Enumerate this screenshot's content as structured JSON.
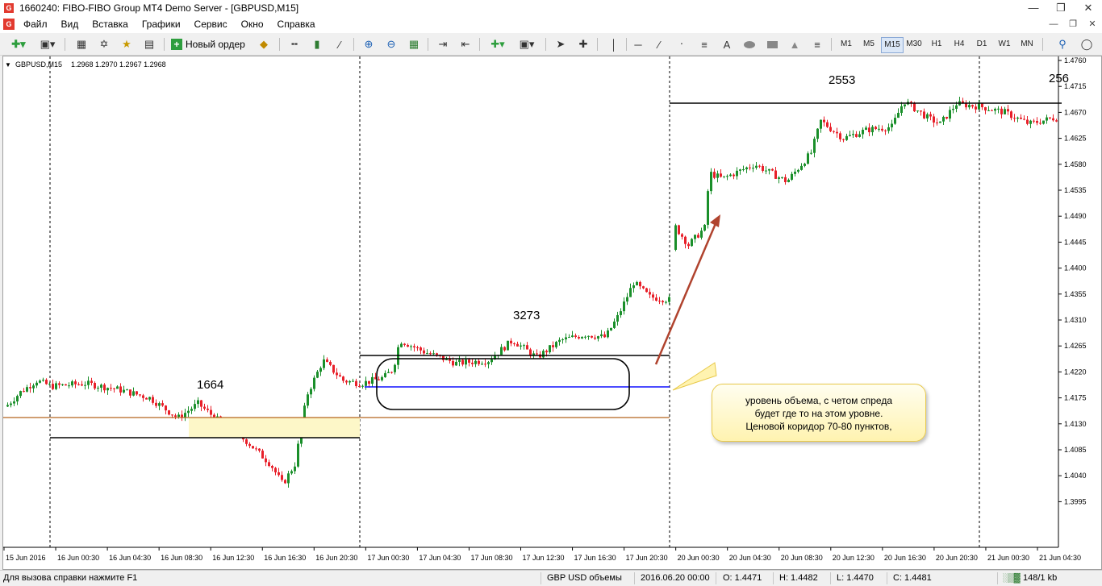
{
  "window": {
    "title": "1660240: FIBO-FIBO Group MT4 Demo Server - [GBPUSD,M15]",
    "app_icon": "G",
    "controls": [
      "minimize-icon",
      "maximize-icon",
      "close-icon"
    ]
  },
  "menu": {
    "items": [
      "Файл",
      "Вид",
      "Вставка",
      "Графики",
      "Сервис",
      "Окно",
      "Справка"
    ]
  },
  "toolbar": {
    "new_order_label": "Новый ордер",
    "timeframes": [
      "M1",
      "M5",
      "M15",
      "M30",
      "H1",
      "H4",
      "D1",
      "W1",
      "MN"
    ],
    "active_timeframe": "M15",
    "draw_tools": [
      "cursor-icon",
      "crosshair-icon",
      "vertical-line-icon",
      "horizontal-line-icon",
      "trendline-icon",
      "channel-icon",
      "text-icon",
      "ellipse-icon",
      "rectangle-icon",
      "triangle-icon",
      "fibo-icon"
    ],
    "text_tool_label": "A"
  },
  "chart": {
    "symbol_label": "GBPUSD,M15",
    "ohlc_label": "1.2968 1.2970 1.2967 1.2968",
    "bull_color": "#1a8f2a",
    "bear_color": "#e8202a",
    "price_ticks": [
      "1.4760",
      "1.4715",
      "1.4670",
      "1.4625",
      "1.4580",
      "1.4535",
      "1.4490",
      "1.4445",
      "1.4400",
      "1.4355",
      "1.4310",
      "1.4265",
      "1.4220",
      "1.4175",
      "1.4130",
      "1.4085",
      "1.4040",
      "1.3995"
    ],
    "time_ticks": [
      "15 Jun 2016",
      "16 Jun 00:30",
      "16 Jun 04:30",
      "16 Jun 08:30",
      "16 Jun 12:30",
      "16 Jun 16:30",
      "16 Jun 20:30",
      "17 Jun 00:30",
      "17 Jun 04:30",
      "17 Jun 08:30",
      "17 Jun 12:30",
      "17 Jun 16:30",
      "17 Jun 20:30",
      "20 Jun 00:30",
      "20 Jun 04:30",
      "20 Jun 08:30",
      "20 Jun 12:30",
      "20 Jun 16:30",
      "20 Jun 20:30",
      "21 Jun 00:30",
      "21 Jun 04:30"
    ],
    "annotations": {
      "label_1": "1664",
      "label_2": "3273",
      "label_3": "2553",
      "label_4": "256"
    },
    "callout": {
      "line1": "уровень объема, с четом спреда",
      "line2": "будет где то на этом уровне.",
      "line3": "Ценовой коридор 70-80 пунктов,"
    }
  },
  "status": {
    "help": "Для вызова справки нажмите F1",
    "profile": "GBP USD объемы",
    "datetime": "2016.06.20 00:00",
    "open": "O: 1.4471",
    "high": "H: 1.4482",
    "low": "L: 1.4470",
    "close": "C: 1.4481",
    "traffic": "148/1 kb"
  }
}
